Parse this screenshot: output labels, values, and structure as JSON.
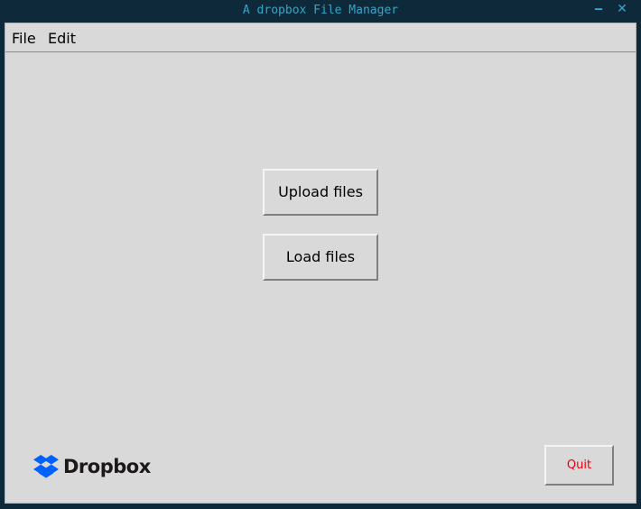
{
  "window": {
    "title": "A dropbox File Manager",
    "minimize_icon": "minimize-icon",
    "close_icon": "close-icon"
  },
  "menubar": {
    "items": [
      {
        "label": "File"
      },
      {
        "label": "Edit"
      }
    ]
  },
  "main": {
    "upload_label": "Upload files",
    "load_label": "Load files",
    "quit_label": "Quit"
  },
  "logo": {
    "text": "Dropbox",
    "icon": "dropbox-logo-icon"
  },
  "colors": {
    "title_text": "#33a6c9",
    "window_frame": "#0e2a3a",
    "client_bg": "#d9d9d9",
    "quit_text": "#e8000c",
    "dropbox_blue": "#0061fe"
  }
}
